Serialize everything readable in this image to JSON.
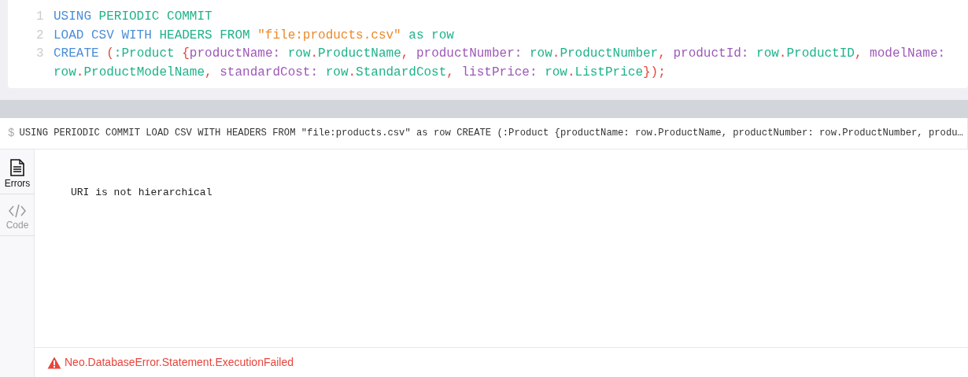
{
  "editor": {
    "lines": [
      {
        "number": "1",
        "tokens": [
          {
            "text": "USING ",
            "kind": "keyword"
          },
          {
            "text": "PERIODIC COMMIT",
            "kind": "ident"
          }
        ]
      },
      {
        "number": "2",
        "tokens": [
          {
            "text": "LOAD CSV WITH ",
            "kind": "keyword"
          },
          {
            "text": "HEADERS FROM ",
            "kind": "ident"
          },
          {
            "text": "\"file:products.csv\"",
            "kind": "string"
          },
          {
            "text": " as row",
            "kind": "ident"
          }
        ]
      },
      {
        "number": "3",
        "tokens": [
          {
            "text": "CREATE ",
            "kind": "keyword"
          },
          {
            "text": "(",
            "kind": "punct"
          },
          {
            "text": ":Product ",
            "kind": "ident"
          },
          {
            "text": "{",
            "kind": "punct"
          },
          {
            "text": "productName: ",
            "kind": "property"
          },
          {
            "text": "row",
            "kind": "ident"
          },
          {
            "text": ".",
            "kind": "punct"
          },
          {
            "text": "ProductName",
            "kind": "ident"
          },
          {
            "text": ", ",
            "kind": "punct"
          },
          {
            "text": "productNumber: ",
            "kind": "property"
          },
          {
            "text": "row",
            "kind": "ident"
          },
          {
            "text": ".",
            "kind": "punct"
          },
          {
            "text": "ProductNumber",
            "kind": "ident"
          },
          {
            "text": ", ",
            "kind": "punct"
          },
          {
            "text": "productId: ",
            "kind": "property"
          },
          {
            "text": "row",
            "kind": "ident"
          },
          {
            "text": ".",
            "kind": "punct"
          },
          {
            "text": "ProductID",
            "kind": "ident"
          },
          {
            "text": ", ",
            "kind": "punct"
          },
          {
            "text": "modelName: ",
            "kind": "property"
          },
          {
            "text": "row",
            "kind": "ident"
          },
          {
            "text": ".",
            "kind": "punct"
          },
          {
            "text": "ProductModelName",
            "kind": "ident"
          },
          {
            "text": ", ",
            "kind": "punct"
          },
          {
            "text": "standardCost: ",
            "kind": "property"
          },
          {
            "text": "row",
            "kind": "ident"
          },
          {
            "text": ".",
            "kind": "punct"
          },
          {
            "text": "StandardCost",
            "kind": "ident"
          },
          {
            "text": ", ",
            "kind": "punct"
          },
          {
            "text": "listPrice: ",
            "kind": "property"
          },
          {
            "text": "row",
            "kind": "ident"
          },
          {
            "text": ".",
            "kind": "punct"
          },
          {
            "text": "ListPrice",
            "kind": "ident"
          },
          {
            "text": "});",
            "kind": "punct"
          }
        ]
      }
    ]
  },
  "result": {
    "prompt": "$",
    "command": "USING PERIODIC COMMIT LOAD CSV WITH HEADERS FROM \"file:products.csv\" as row CREATE (:Product {productName: row.ProductName, productNumber: row.ProductNumber, produ…",
    "tabs": [
      {
        "label": "Errors",
        "kind": "document",
        "selected": true
      },
      {
        "label": "Code",
        "kind": "code",
        "selected": false
      }
    ],
    "message": "URI is not hierarchical",
    "error": "Neo.DatabaseError.Statement.ExecutionFailed"
  }
}
